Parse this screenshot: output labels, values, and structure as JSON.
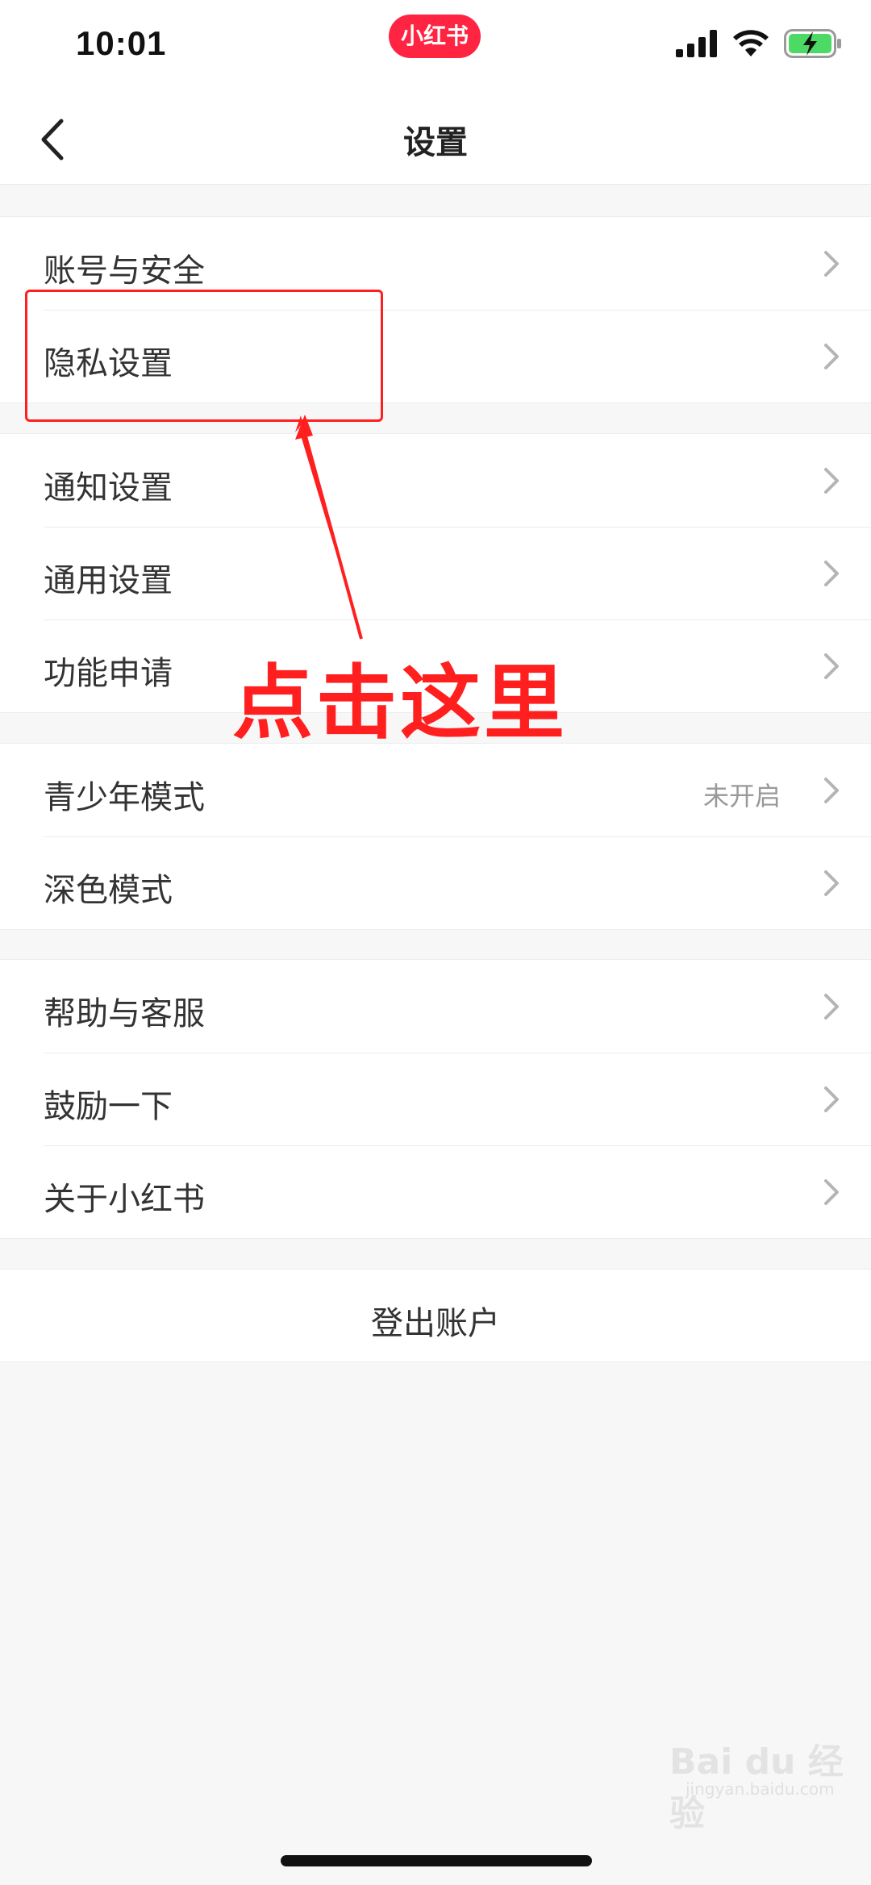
{
  "status_bar": {
    "time": "10:01",
    "app_badge": "小红书",
    "icons": [
      "signal-icon",
      "wifi-icon",
      "battery-charging-icon"
    ]
  },
  "nav": {
    "title": "设置",
    "back_icon": "chevron-left-icon"
  },
  "groups": [
    {
      "items": [
        {
          "label": "账号与安全"
        },
        {
          "label": "隐私设置"
        }
      ]
    },
    {
      "items": [
        {
          "label": "通知设置"
        },
        {
          "label": "通用设置"
        },
        {
          "label": "功能申请"
        }
      ]
    },
    {
      "items": [
        {
          "label": "青少年模式",
          "value": "未开启"
        },
        {
          "label": "深色模式"
        }
      ]
    },
    {
      "items": [
        {
          "label": "帮助与客服"
        },
        {
          "label": "鼓励一下"
        },
        {
          "label": "关于小红书"
        }
      ]
    }
  ],
  "logout": {
    "label": "登出账户"
  },
  "annotation": {
    "text": "点击这里",
    "color": "#ff1f1f"
  },
  "watermark": {
    "text": "Bai du 经验",
    "sub": "jingyan.baidu.com"
  },
  "colors": {
    "brand": "#ff2442",
    "background": "#f7f7f7",
    "annotation": "#ff1f1f"
  }
}
